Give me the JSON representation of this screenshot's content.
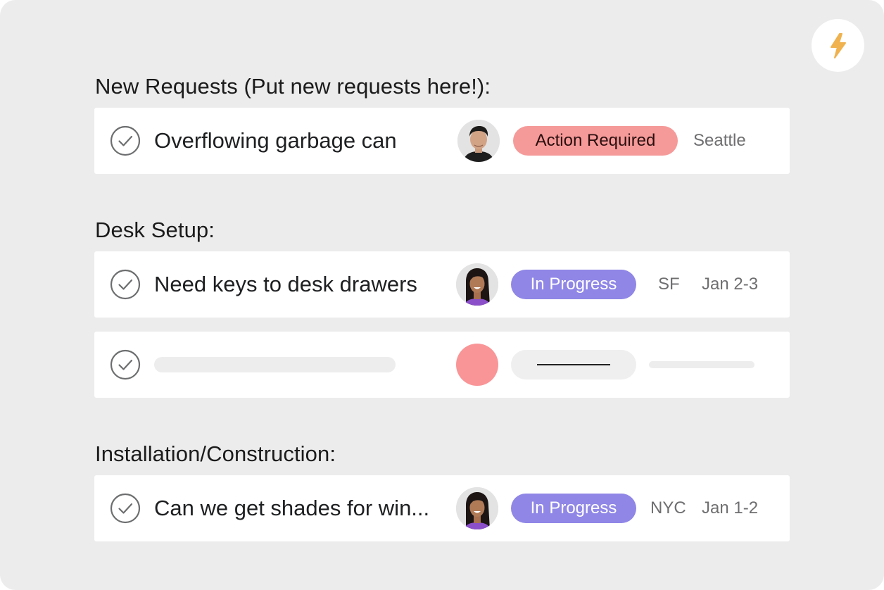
{
  "toolbar": {
    "bolt_icon": "lightning-bolt-icon",
    "bolt_color": "#efb24f"
  },
  "sections": [
    {
      "title": "New Requests (Put new requests here!):",
      "tasks": [
        {
          "name": "Overflowing garbage can",
          "assignee_avatar": "man-avatar",
          "status": "Action Required",
          "status_color": "#f59a99",
          "location": "Seattle",
          "date": ""
        }
      ]
    },
    {
      "title": "Desk Setup:",
      "tasks": [
        {
          "name": "Need keys to desk drawers",
          "assignee_avatar": "woman-avatar",
          "status": "In Progress",
          "status_color": "#8f86e6",
          "location": "SF",
          "date": "Jan 2-3"
        },
        {
          "name": "",
          "placeholder": true,
          "assignee_avatar_color": "#f99597"
        }
      ]
    },
    {
      "title": "Installation/Construction:",
      "tasks": [
        {
          "name": "Can we get shades for win...",
          "assignee_avatar": "woman-avatar",
          "status": "In Progress",
          "status_color": "#8f86e6",
          "location": "NYC",
          "date": "Jan 1-2"
        }
      ]
    }
  ]
}
